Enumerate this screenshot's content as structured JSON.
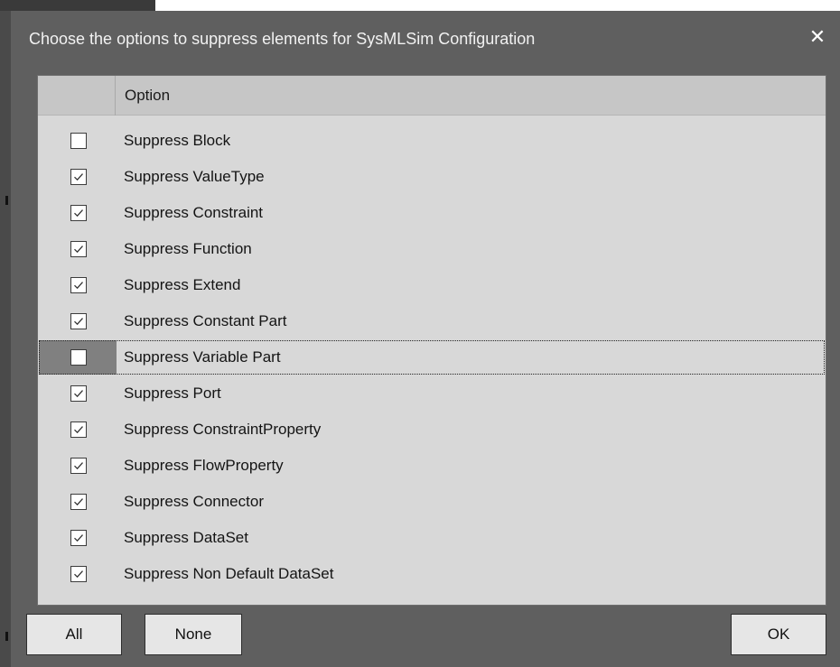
{
  "dialog": {
    "title": "Choose the options to suppress elements for SysMLSim Configuration",
    "close_glyph": "✕"
  },
  "grid": {
    "column_header": "Option",
    "rows": [
      {
        "label": "Suppress Block",
        "checked": false
      },
      {
        "label": "Suppress ValueType",
        "checked": true
      },
      {
        "label": "Suppress Constraint",
        "checked": true
      },
      {
        "label": "Suppress Function",
        "checked": true
      },
      {
        "label": "Suppress Extend",
        "checked": true
      },
      {
        "label": "Suppress Constant Part",
        "checked": true
      },
      {
        "label": "Suppress Variable Part",
        "checked": false,
        "focused": true
      },
      {
        "label": "Suppress Port",
        "checked": true
      },
      {
        "label": "Suppress ConstraintProperty",
        "checked": true
      },
      {
        "label": "Suppress FlowProperty",
        "checked": true
      },
      {
        "label": "Suppress Connector",
        "checked": true
      },
      {
        "label": "Suppress DataSet",
        "checked": true
      },
      {
        "label": "Suppress Non Default DataSet",
        "checked": true
      }
    ]
  },
  "buttons": {
    "all": "All",
    "none": "None",
    "ok": "OK"
  },
  "colors": {
    "dialog_bg": "#5f5f5f",
    "grid_bg": "#d8d8d8",
    "button_bg": "#e6e6e6"
  }
}
